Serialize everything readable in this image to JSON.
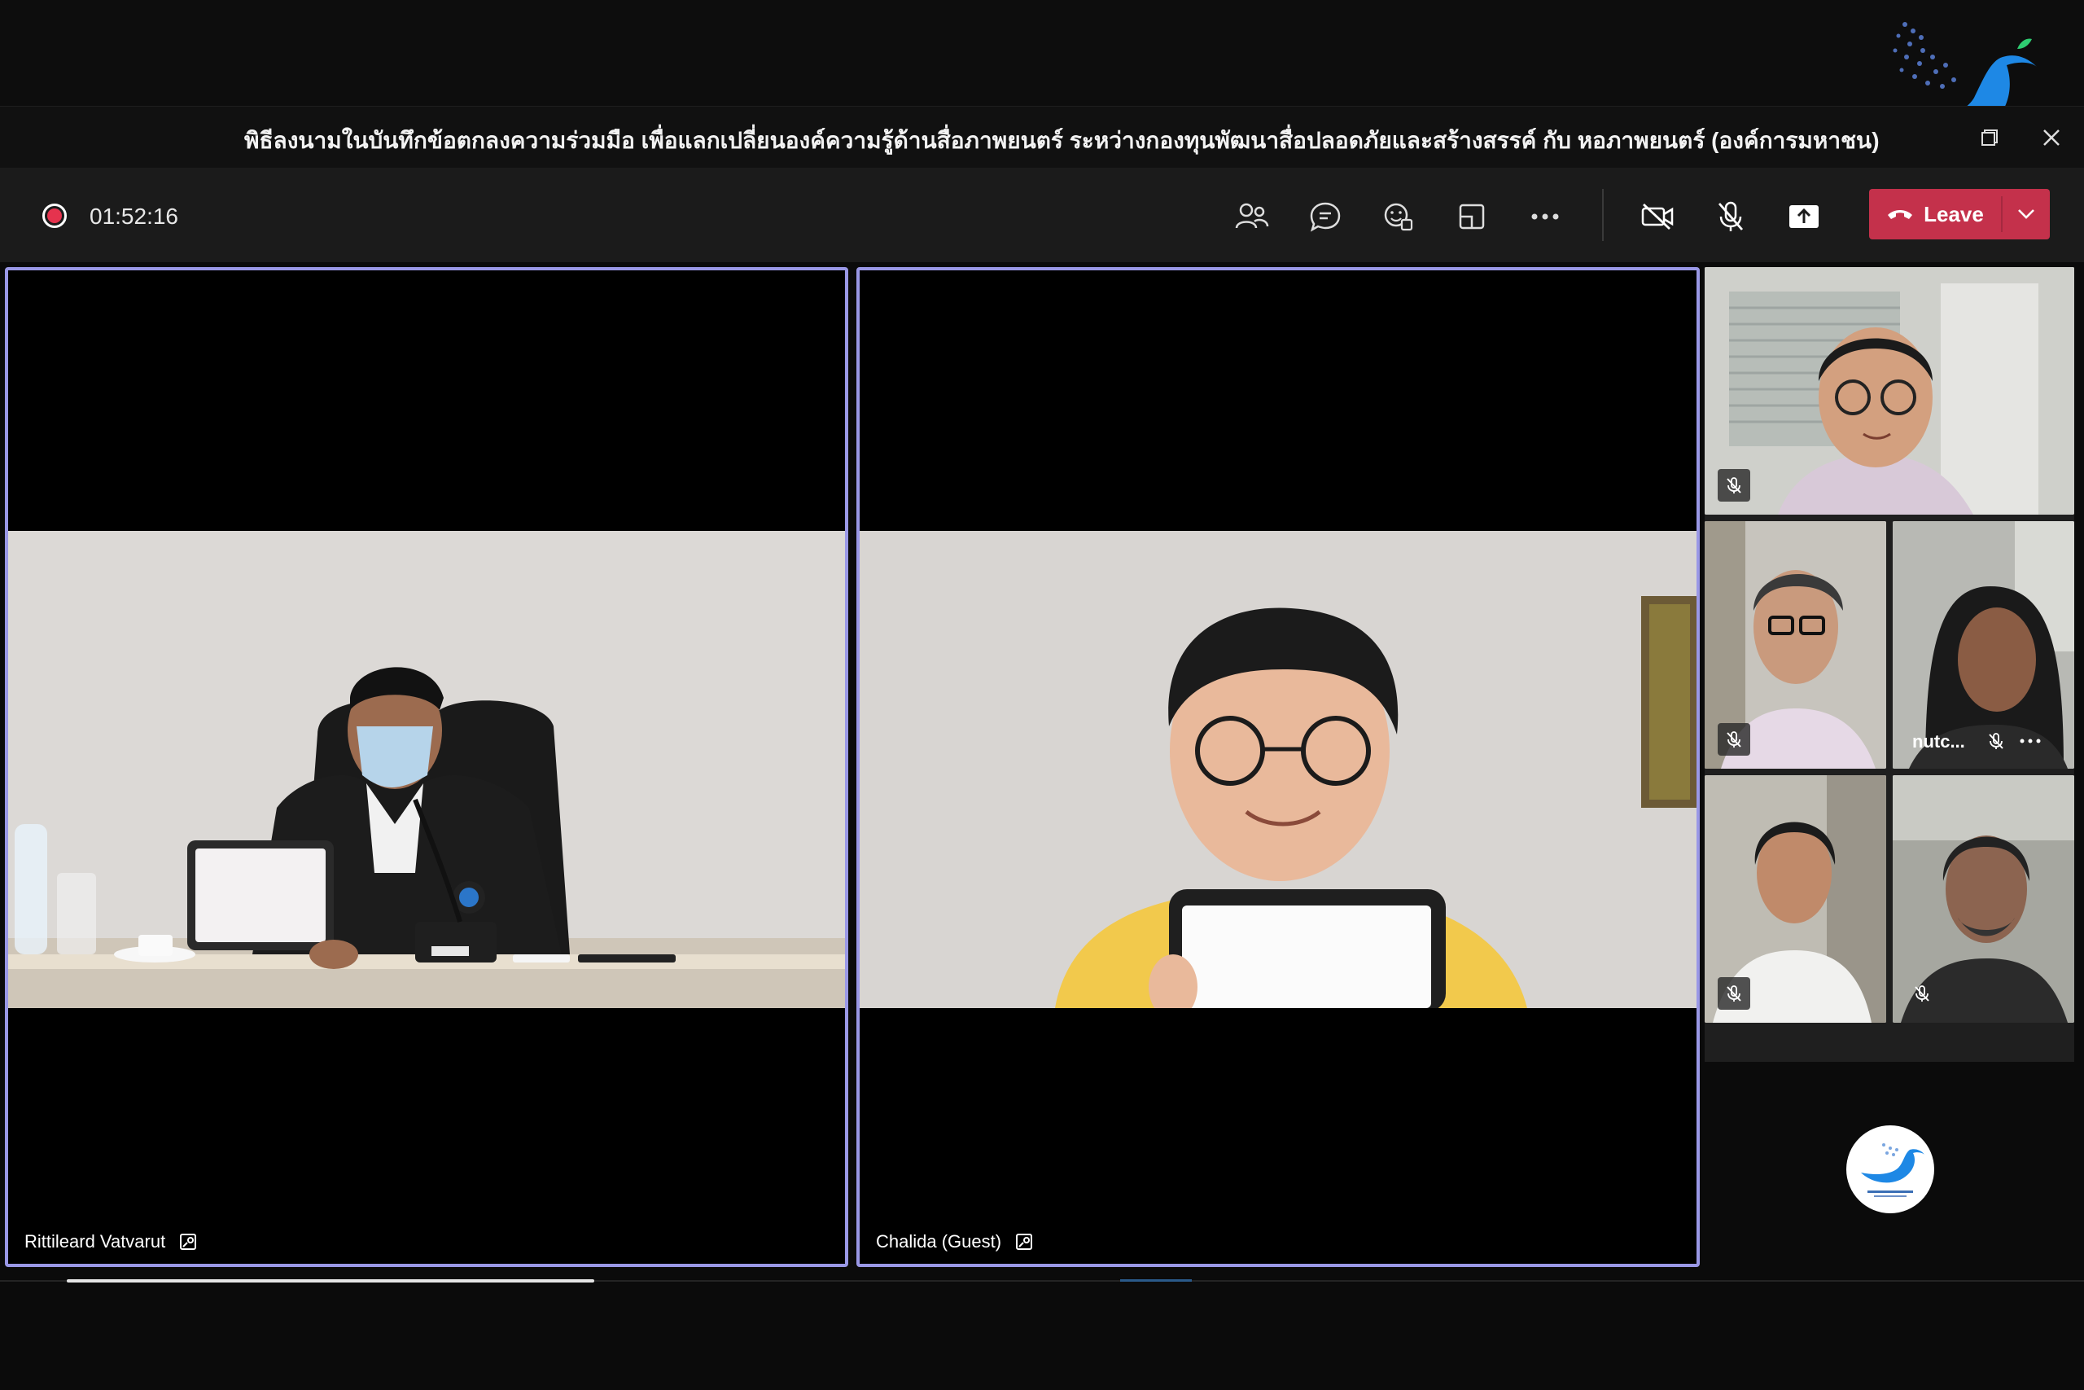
{
  "meeting": {
    "title": "พิธีลงนามในบันทึกข้อตกลงความร่วมมือ เพื่อแลกเปลี่ยนองค์ความรู้ด้านสื่อภาพยนตร์ ระหว่างกองทุนพัฒนาสื่อปลอดภัยและสร้างสรรค์ กับ หอภาพยนตร์ (องค์การมหาชน)",
    "elapsed": "01:52:16"
  },
  "toolbar": {
    "icons": [
      "people-icon",
      "chat-icon",
      "reactions-icon",
      "rooms-icon",
      "more-icon",
      "camera-off-icon",
      "mic-off-icon",
      "share-icon"
    ],
    "leave_label": "Leave"
  },
  "participants": [
    {
      "name": "Rittileard Vatvarut",
      "pinned": true
    },
    {
      "name": "Chalida (Guest)",
      "pinned": true
    }
  ],
  "gallery": [
    {
      "label": "",
      "muted": true
    },
    {
      "label": "",
      "muted": true
    },
    {
      "label": "nutc...",
      "muted": true
    },
    {
      "label": "",
      "muted": true
    },
    {
      "label": "",
      "muted": true
    }
  ],
  "colors": {
    "accent_border": "#9a98e6",
    "leave_red": "#c4314b",
    "record_red": "#e5334e",
    "logo_blue": "#1e88e5"
  }
}
